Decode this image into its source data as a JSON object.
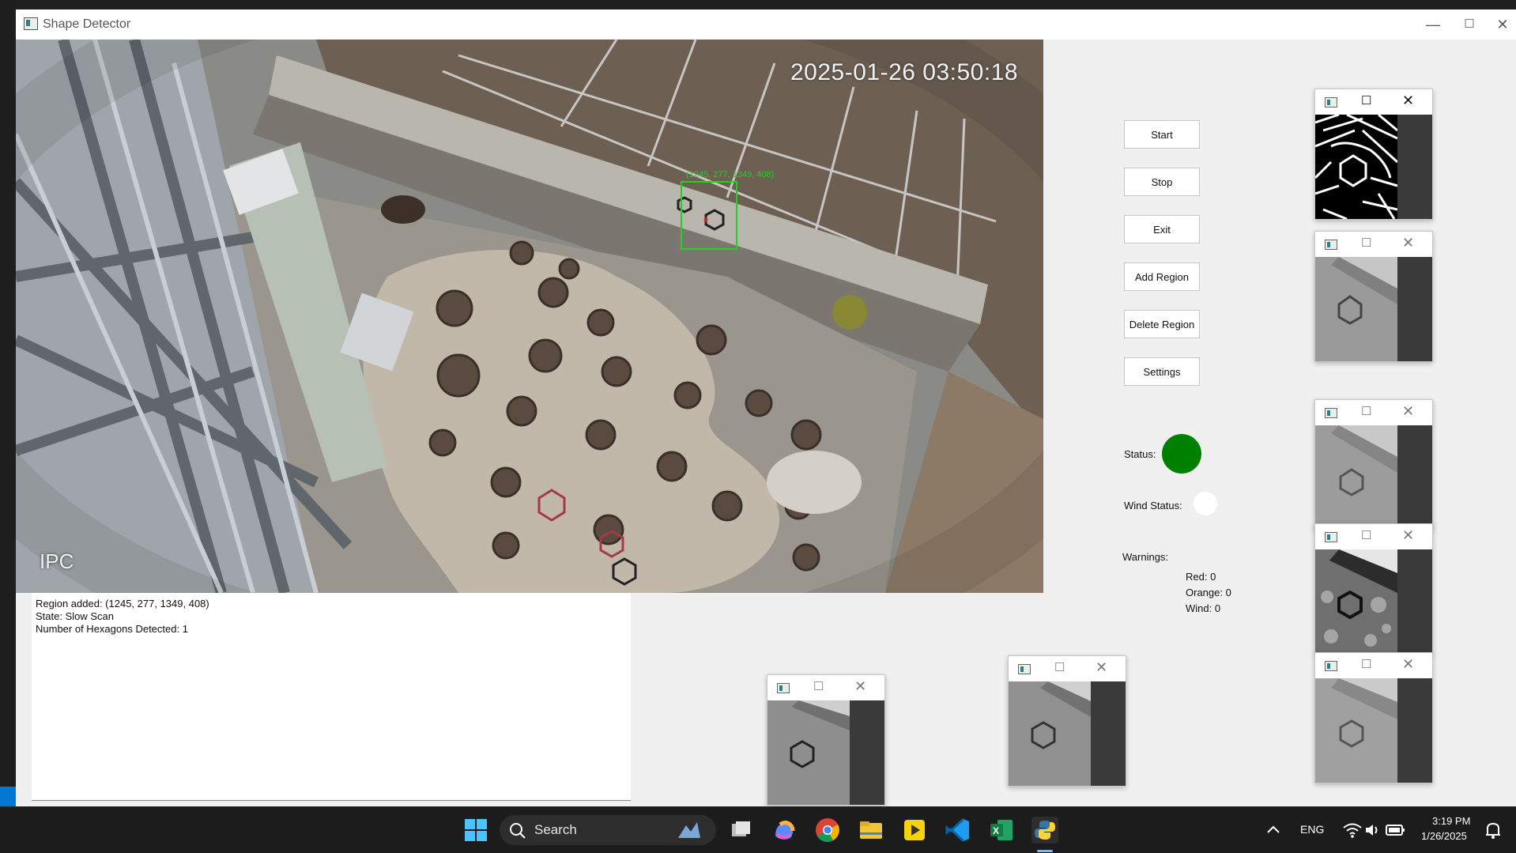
{
  "window": {
    "title": "Shape Detector",
    "controls": {
      "minimize": "—",
      "maximize": "☐",
      "close": "✕"
    }
  },
  "camera": {
    "timestamp": "2025-01-26 03:50:18",
    "overlay_label": "IPC",
    "region_label": "(1245, 277, 1349, 408)"
  },
  "log": {
    "lines": [
      "Region added: (1245, 277, 1349, 408)",
      "State: Slow Scan",
      "Number of Hexagons Detected: 1"
    ]
  },
  "buttons": {
    "start": "Start",
    "stop": "Stop",
    "exit": "Exit",
    "add_region": "Add Region",
    "delete_region": "Delete Region",
    "settings": "Settings"
  },
  "status": {
    "status_label": "Status:",
    "status_color": "#008000",
    "wind_label": "Wind Status:",
    "wind_color": "#ffffff",
    "warnings_label": "Warnings:",
    "red": "Red: 0",
    "orange": "Orange: 0",
    "wind": "Wind: 0"
  },
  "mini_windows": [
    {
      "id": "binary-mask",
      "controls": {
        "maximize": "☐",
        "close": "✕"
      }
    },
    {
      "id": "gray-preview-1",
      "controls": {
        "maximize": "☐",
        "close": "✕"
      }
    },
    {
      "id": "gray-preview-2",
      "controls": {
        "maximize": "☐",
        "close": "✕"
      }
    },
    {
      "id": "contrast-preview",
      "controls": {
        "maximize": "☐",
        "close": "✕"
      }
    },
    {
      "id": "gray-preview-3",
      "controls": {
        "maximize": "☐",
        "close": "✕"
      }
    },
    {
      "id": "bottom-preview-1",
      "controls": {
        "maximize": "☐",
        "close": "✕"
      }
    },
    {
      "id": "bottom-preview-2",
      "controls": {
        "maximize": "☐",
        "close": "✕"
      }
    }
  ],
  "taskbar": {
    "search_label": "Search",
    "language": "ENG",
    "time": "3:19 PM",
    "date": "1/26/2025",
    "apps": [
      "windows-start-icon",
      "task-view-icon",
      "copilot-icon",
      "chrome-icon",
      "file-explorer-icon",
      "player-icon",
      "vscode-icon",
      "excel-icon",
      "python-icon"
    ]
  }
}
